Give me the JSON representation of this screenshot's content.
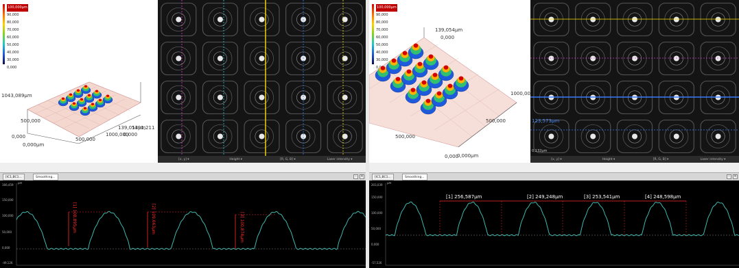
{
  "scale_labels": [
    "100,000μm",
    "90,000",
    "80,000",
    "70,000",
    "60,000",
    "50,000",
    "40,000",
    "30,000",
    "20,000",
    "0,000"
  ],
  "left": {
    "axis_labels": {
      "z_top": "139,054μm",
      "z_zero": "0,000",
      "y_max": "1043,089μm",
      "y_mid": "500,000",
      "x_origin_a": "0,000",
      "x_origin_b": "0,000μm",
      "x_mid": "500,000",
      "x_near_max": "1000,000",
      "x_max": "1391,211"
    },
    "camera_strip": [
      "[x, y] ▾",
      "Height ▾",
      "[R, G, B] ▾",
      "Laser intensity ▾"
    ],
    "tabs": [
      "[IC1,BC1...",
      "Smoothing..."
    ],
    "profile": {
      "y_ticks": [
        "150,000",
        "100,000",
        "50,000",
        "0,000",
        "-50,000"
      ],
      "y_top_label": "166,459",
      "y_bottom_label": "-49,126",
      "unit": "μm",
      "measurements": [
        "[1] 108,895μm",
        "[2] 109,663μm",
        "[3] 100,874μm"
      ]
    }
  },
  "right": {
    "axis_labels": {
      "z_top": "139,054μm",
      "z_zero": "0,000",
      "x_near_max": "1000,00",
      "x_mid": "500,000",
      "x_low": "500,000",
      "origin_a": "0,000",
      "origin_b": "0,000μm"
    },
    "camera_labels": {
      "row_value": "123,573μm",
      "corner_value": "0,132μm"
    },
    "camera_strip": [
      "[x, y] ▾",
      "Height ▾",
      "[R, G, B] ▾",
      "Laser intensity ▾"
    ],
    "tabs": [
      "[IC1,BC1...",
      "Smoothing..."
    ],
    "profile": {
      "y_ticks": [
        "150,000",
        "100,000",
        "50,000",
        "0,000",
        "-50,000"
      ],
      "y_top_label": "203,039",
      "y_bottom_label": "-57,526",
      "unit": "μm",
      "measurements": [
        "[1] 256,587μm",
        "[2] 249,248μm",
        "[3] 253,541μm",
        "[4] 248,598μm"
      ]
    }
  },
  "colors": {
    "profile_line": "#3fb8b0",
    "measure_red": "#ff2a2a",
    "camera_bg": "#141414",
    "crosshair_yellow": "#ffe000",
    "crosshair_magenta": "#d040d0",
    "crosshair_cyan": "#30c8d8",
    "crosshair_blue": "#3a7cff"
  }
}
